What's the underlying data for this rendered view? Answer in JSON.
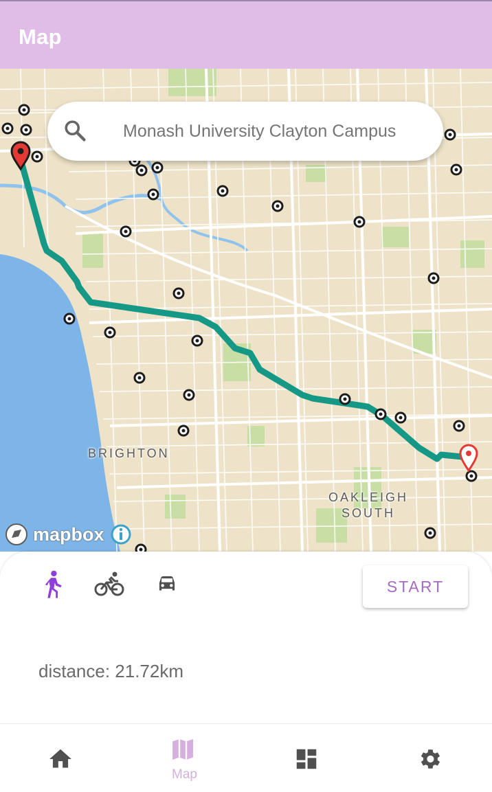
{
  "app": {
    "title": "Map",
    "accent_color": "#e0bde6",
    "active_color": "#a66bc0"
  },
  "search": {
    "placeholder": "Monash University Clayton Campus",
    "icon": "search-icon"
  },
  "map": {
    "provider": "mapbox",
    "labels": {
      "brighton": "BRIGHTON",
      "oakleigh_line1": "OAKLEIGH",
      "oakleigh_line2": "SOUTH"
    },
    "route_color": "#169886",
    "marker_color": "#e53935"
  },
  "panel": {
    "modes": [
      {
        "name": "walk",
        "icon": "walk-icon",
        "selected": true
      },
      {
        "name": "bike",
        "icon": "bike-icon",
        "selected": false
      },
      {
        "name": "car",
        "icon": "car-icon",
        "selected": false
      }
    ],
    "start_label": "START",
    "distance_text": "distance: 21.72km"
  },
  "bottom_nav": {
    "items": [
      {
        "icon": "home-icon",
        "label": ""
      },
      {
        "icon": "map-icon",
        "label": "Map",
        "active": true
      },
      {
        "icon": "dashboard-icon",
        "label": ""
      },
      {
        "icon": "settings-icon",
        "label": ""
      }
    ]
  }
}
